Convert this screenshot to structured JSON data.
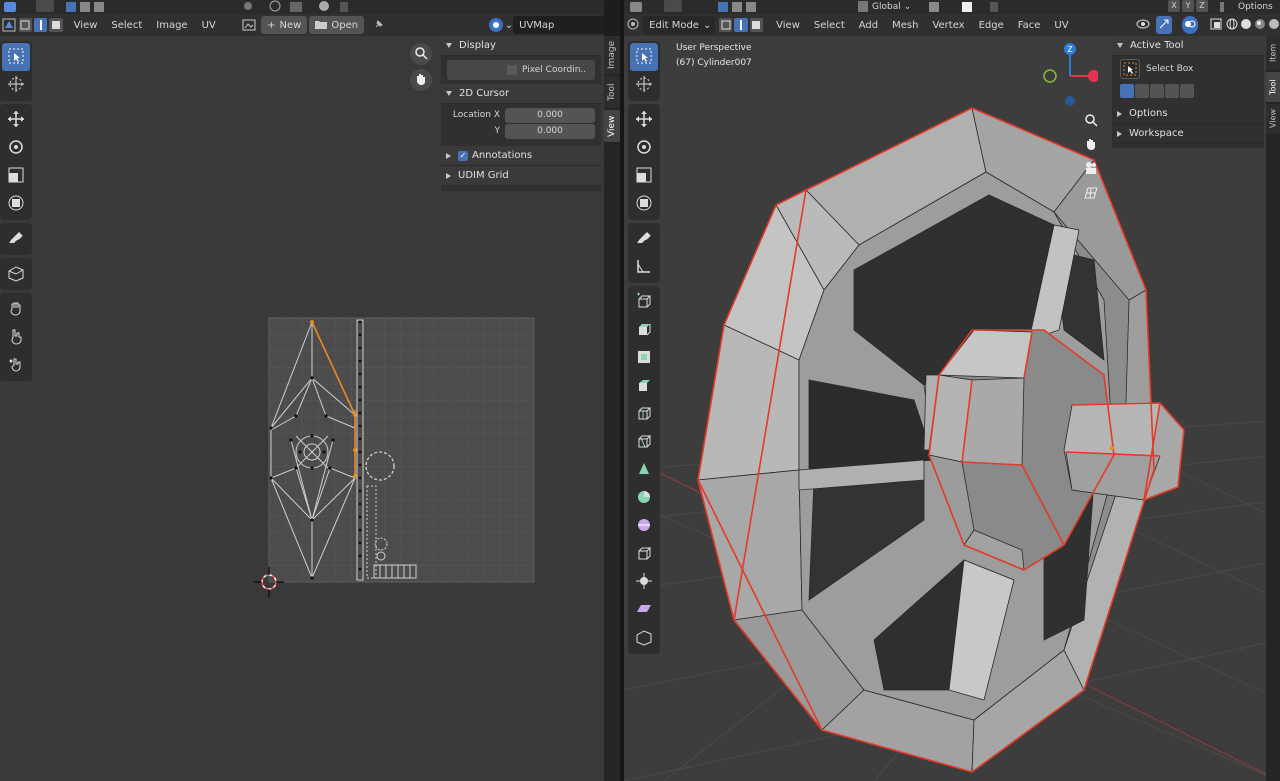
{
  "uv_editor": {
    "menu": [
      "View",
      "Select",
      "Image",
      "UV"
    ],
    "new_label": "New",
    "open_label": "Open",
    "uvmap_value": "UVMap",
    "sidebar": {
      "display_title": "Display",
      "pixel_coords_label": "Pixel Coordin..",
      "cursor_title": "2D Cursor",
      "location_x_label": "Location X",
      "location_x_value": "0.000",
      "y_label": "Y",
      "y_value": "0.000",
      "annotations_label": "Annotations",
      "udim_label": "UDIM Grid"
    },
    "tabs": [
      "Image",
      "Tool",
      "View"
    ]
  },
  "viewport": {
    "mode_label": "Edit Mode",
    "menu": [
      "View",
      "Select",
      "Add",
      "Mesh",
      "Vertex",
      "Edge",
      "Face",
      "UV"
    ],
    "orientation_label": "Global",
    "axis_buttons": [
      "X",
      "Y",
      "Z"
    ],
    "options_label": "Options",
    "perspective_text": "User Perspective",
    "object_text": "(67) Cylinder007",
    "gizmo": {
      "z": "Z",
      "colors": {
        "x": "#e2344e",
        "y": "#8bbd2b",
        "z": "#2d7cda"
      }
    },
    "sidebar": {
      "active_tool_title": "Active Tool",
      "select_box_label": "Select Box",
      "options_title": "Options",
      "workspace_title": "Workspace"
    },
    "tabs": [
      "Item",
      "Tool",
      "View"
    ]
  },
  "colors": {
    "accent": "#4772b3",
    "edge_selected": "#e33a2a",
    "uv_selected": "#e88a1d"
  }
}
